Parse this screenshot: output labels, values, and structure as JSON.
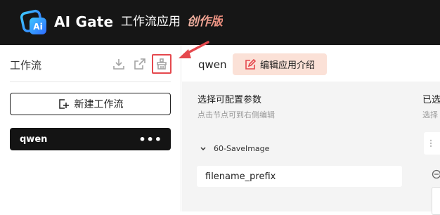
{
  "header": {
    "brand": "AI Gate",
    "app_title": "工作流应用",
    "badge": "创作版",
    "logo_mark_text": "Ai"
  },
  "sidebar": {
    "title": "工作流",
    "tools": [
      {
        "icon": "download-icon"
      },
      {
        "icon": "external-link-icon"
      },
      {
        "icon": "clean-brush-icon",
        "highlighted": true
      }
    ],
    "new_button_label": "新建工作流",
    "workflows": [
      {
        "name": "qwen",
        "more": "•••"
      }
    ]
  },
  "main": {
    "workflow_name": "qwen",
    "edit_intro_label": "编辑应用介绍",
    "left_section": {
      "title": "选择可配置参数",
      "subtitle": "点击节点可到右侧编辑",
      "node": {
        "label": "60-SaveImage"
      },
      "params": [
        {
          "name": "filename_prefix"
        }
      ]
    },
    "right_section": {
      "title": "已选",
      "subtitle": "选择"
    }
  },
  "colors": {
    "topbar": "#161616",
    "accent_badge": "#e98a7a",
    "edit_btn_bg": "#fbe1d7",
    "highlight": "#e5484d",
    "panel_bg": "#f4f4f4"
  }
}
